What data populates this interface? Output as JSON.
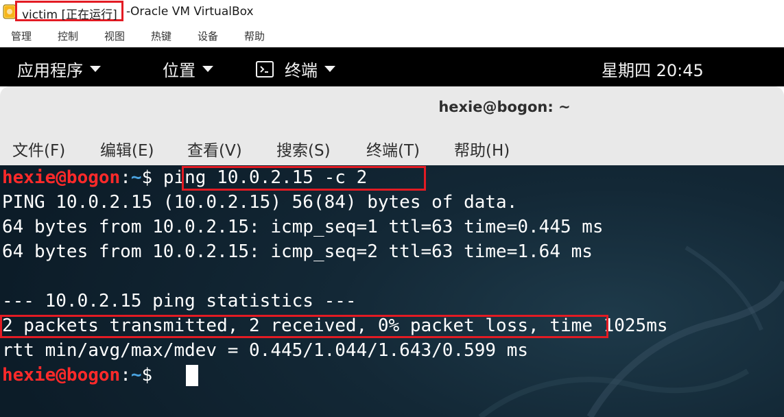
{
  "vbox": {
    "vm_title": "victim [正在运行]",
    "title_separator": "-",
    "app_title": "Oracle VM VirtualBox",
    "menu": [
      "管理",
      "控制",
      "视图",
      "热键",
      "设备",
      "帮助"
    ]
  },
  "gnome": {
    "applications": "应用程序",
    "places": "位置",
    "terminal": "终端",
    "clock": "星期四 20:45"
  },
  "terminal": {
    "title": "hexie@bogon: ~",
    "menu": [
      "文件(F)",
      "编辑(E)",
      "查看(V)",
      "搜索(S)",
      "终端(T)",
      "帮助(H)"
    ],
    "prompt_user": "hexie@bogon",
    "prompt_sep": ":",
    "prompt_dir": "~",
    "prompt_symbol": "$ ",
    "command": "ping 10.0.2.15 -c 2",
    "output": [
      "PING 10.0.2.15 (10.0.2.15) 56(84) bytes of data.",
      "64 bytes from 10.0.2.15: icmp_seq=1 ttl=63 time=0.445 ms",
      "64 bytes from 10.0.2.15: icmp_seq=2 ttl=63 time=1.64 ms",
      "",
      "--- 10.0.2.15 ping statistics ---"
    ],
    "summary_highlight": "2 packets transmitted, 2 received, 0% packet loss",
    "summary_rest": ", time 1025ms",
    "rtt": "rtt min/avg/max/mdev = 0.445/1.044/1.643/0.599 ms"
  },
  "colors": {
    "highlight": "#e31b23",
    "prompt_user": "#ff2a2a",
    "prompt_dir": "#4aa3e0",
    "terminal_bg": "#132836"
  }
}
